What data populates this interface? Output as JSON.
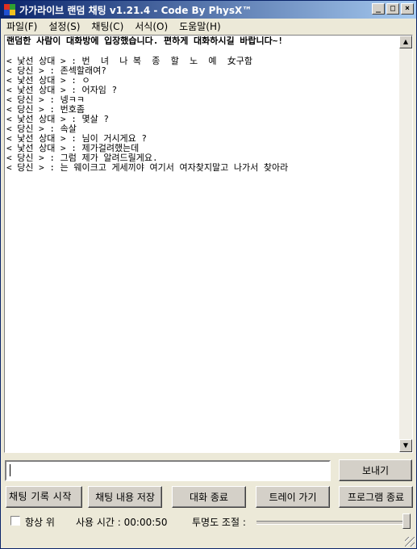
{
  "window": {
    "title": "가가라이브 랜덤 채팅 v1.21.4 - Code By PhysX™",
    "min_glyph": "_",
    "max_glyph": "□",
    "close_glyph": "×"
  },
  "menu": [
    {
      "label": "파일(F)"
    },
    {
      "label": "설정(S)"
    },
    {
      "label": "채팅(C)"
    },
    {
      "label": "서식(O)"
    },
    {
      "label": "도움말(H)"
    }
  ],
  "chat": {
    "notice": "랜덤한 사람이 대화방에 입장했습니다. 편하게 대화하시길 바랍니다~!",
    "lines": [
      "< 낯선 상대 > : 번  녀  나 복  종  할  노  예  女구함",
      "< 당신 > : 존섹할래여?",
      "< 낯선 상대 > : ㅇ",
      "< 낯선 상대 > : 어자임 ?",
      "< 당신 > : 넹ㅋㅋ",
      "< 당신 > : 번호좀",
      "< 낯선 상대 > : 몇살 ?",
      "< 당신 > : 속살",
      "< 낯선 상대 > : 님이 거시게요 ?",
      "< 낯선 상대 > : 제가걸려했는데",
      "< 당신 > : 그럼 제가 알려드릴게요.",
      "< 당신 > : 는 웨이크고 게세끼야 여기서 여자찾지말고 나가서 찾아라"
    ]
  },
  "input": {
    "value": "",
    "placeholder": ""
  },
  "buttons": {
    "send": "보내기",
    "save_log": "채팅 기록 시작",
    "save_chat": "채팅 내용 저장",
    "end_chat": "대화 종료",
    "tray": "트레이 가기",
    "exit": "프로그램 종료"
  },
  "options": {
    "always_on_top": "항상 위",
    "always_on_top_checked": false,
    "usage_time": "사용 시간 : 00:00:50",
    "opacity_label": "투명도 조절 :",
    "opacity_value": 1.0
  }
}
